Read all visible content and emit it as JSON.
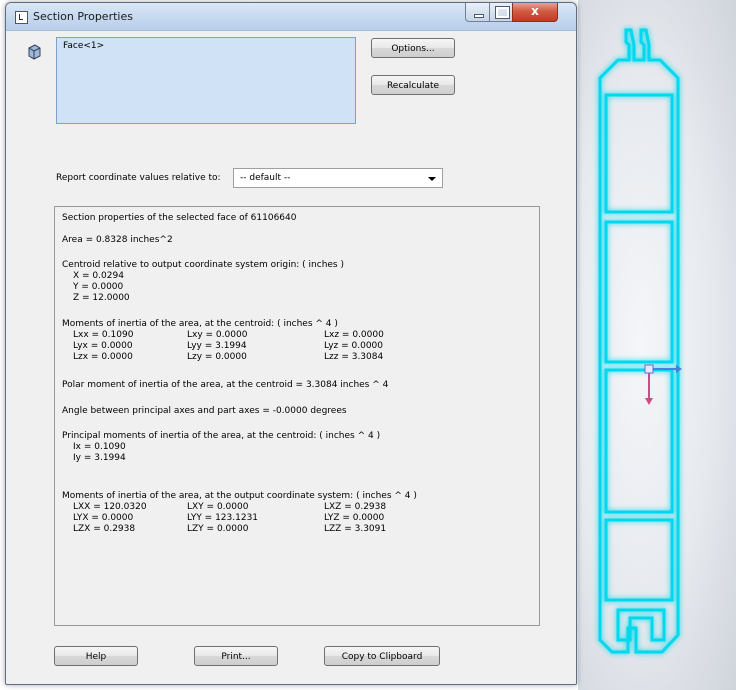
{
  "window": {
    "title": "Section Properties"
  },
  "selection": {
    "item": "Face<1>"
  },
  "buttons": {
    "options": "Options...",
    "recalculate": "Recalculate",
    "help": "Help",
    "print": "Print...",
    "copy": "Copy to Clipboard"
  },
  "coordinates": {
    "label": "Report coordinate values relative to:",
    "selected": "-- default --"
  },
  "results": {
    "header": "Section properties of the selected face of 61106640",
    "area": "Area = 0.8328 inches^2",
    "centroid_title": "Centroid relative to output coordinate system origin: ( inches )",
    "centroid": [
      "X = 0.0294",
      "Y = 0.0000",
      "Z = 12.0000"
    ],
    "moi_centroid_title": "Moments of inertia of the area, at the centroid: ( inches ^ 4 )",
    "moi_centroid": [
      [
        "Lxx = 0.1090",
        "Lxy = 0.0000",
        "Lxz = 0.0000"
      ],
      [
        "Lyx = 0.0000",
        "Lyy = 3.1994",
        "Lyz = 0.0000"
      ],
      [
        "Lzx = 0.0000",
        "Lzy = 0.0000",
        "Lzz = 3.3084"
      ]
    ],
    "polar": "Polar moment of inertia of the area, at the centroid = 3.3084 inches ^ 4",
    "angle": "Angle between principal axes and part axes = -0.0000 degrees",
    "principal_title": "Principal moments of inertia of the area, at the centroid: ( inches ^ 4 )",
    "principal": [
      "Ix = 0.1090",
      "Iy = 3.1994"
    ],
    "moi_output_title": "Moments of inertia of the area, at the output coordinate system: ( inches ^ 4 )",
    "moi_output": [
      [
        "LXX = 120.0320",
        "LXY = 0.0000",
        "LXZ = 0.2938"
      ],
      [
        "LYX = 0.0000",
        "LYY = 123.1231",
        "LYZ = 0.0000"
      ],
      [
        "LZX = 0.2938",
        "LZY = 0.0000",
        "LZZ = 3.3091"
      ]
    ]
  },
  "colors": {
    "profile_glow": "#6ff0ff",
    "profile_core": "#00d8ee",
    "triad_x": "#4a7fe0",
    "triad_y": "#d04a8a"
  }
}
